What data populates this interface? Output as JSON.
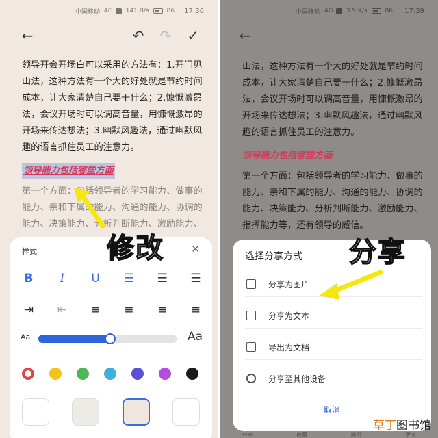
{
  "left": {
    "status": {
      "carrier": "中国移动",
      "network": "4G",
      "speed": "141 B/s",
      "battery": "86",
      "time": "17:36"
    },
    "toolbar": {
      "back_icon": "back-arrow-icon",
      "undo_icon": "undo-icon",
      "redo_icon": "redo-icon",
      "confirm_icon": "check-icon"
    },
    "paragraph": "领导开会开场白可以采用的方法有：1.开门见山法，这种方法有一个大的好处就是节约时间成本，让大家清楚自己要干什么；2.慷慨激昂法，会议开场时可以调高音量，用慷慨激昂的开场来传达想法；3.幽默风趣法，通过幽默风趣的语言抓住员工的注意力。",
    "heading": "领导能力包括哪些方面",
    "paragraph2": "第一个方面：包括领导者的学习能力、做事的能力、亲和下属的能力、沟通的能力、协调的能力、决策能力、分析判断能力、激励能力、",
    "overlay_label": "修改",
    "style_sheet": {
      "title": "样式",
      "font_size_small": "Aa",
      "font_size_large": "Aa",
      "font_size_level": 0.52,
      "format_buttons": [
        "B",
        "I",
        "U"
      ],
      "colors": [
        "#e0463d",
        "#f2c318",
        "#4fb655",
        "#3fb0de",
        "#5a4fd6",
        "#b54be0",
        "#1a1a1a"
      ],
      "backgrounds": [
        "#ffffff",
        "#ecebe6",
        "#efe6df",
        "#ffffff"
      ]
    }
  },
  "right": {
    "status": {
      "carrier": "中国移动",
      "network": "4G",
      "speed": "3.9 K/s",
      "battery": "86",
      "time": "17:39"
    },
    "toolbar": {
      "back_icon": "back-arrow-icon"
    },
    "paragraph": "山法，这种方法有一个大的好处就是节约时间成本，让大家清楚自己要干什么；2.慷慨激昂法，会议开场时可以调高音量，用慷慨激昂的开场来传达想法；3.幽默风趣法，通过幽默风趣的语言抓住员工的注意力。",
    "heading": "领导能力包括哪些方面",
    "paragraph2": "第一个方面：包括领导者的学习能力、做事的能力、亲和下属的能力、沟通的能力、协调的能力、决策能力、分析判断能力、激励能力、指挥能力等，还有领导的威信。",
    "overlay_label": "分享",
    "share_sheet": {
      "title": "选择分享方式",
      "items": [
        "分享为图片",
        "分享为文本",
        "导出为文档",
        "分享至其他设备"
      ],
      "cancel": "取消"
    },
    "bottom_nav": [
      "分享",
      "收藏",
      "删除",
      "更多"
    ]
  },
  "watermark": {
    "part1": "草丁",
    "part2": "图书馆"
  }
}
